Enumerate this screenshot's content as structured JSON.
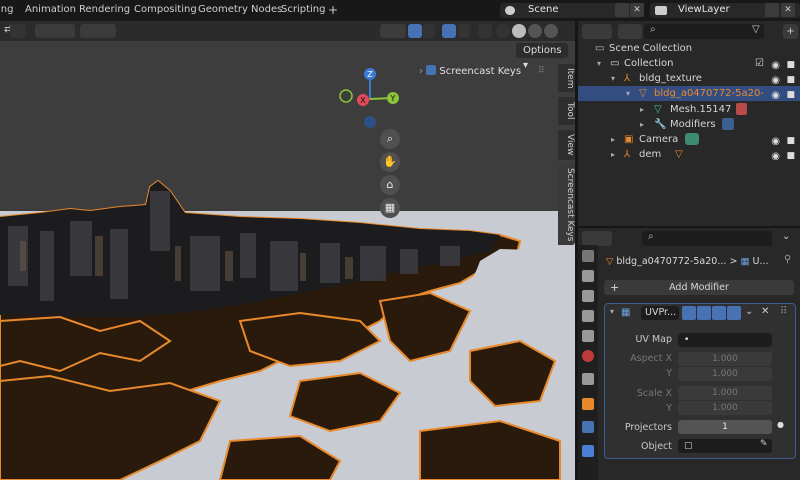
{
  "topbar": {
    "tabs": [
      "ing",
      "Animation",
      "Rendering",
      "Compositing",
      "Geometry Nodes",
      "Scripting"
    ],
    "add_tab": "+",
    "scene": "Scene",
    "view_layer": "ViewLayer"
  },
  "viewport": {
    "options": "Options",
    "screencast_label": "Screencast Keys",
    "side_tabs": [
      "Item",
      "Tool",
      "View",
      "Screencast Keys"
    ],
    "gizmo_axes": [
      "X",
      "Y",
      "Z"
    ]
  },
  "outliner": {
    "search_placeholder": "",
    "items": [
      {
        "label": "Scene Collection"
      },
      {
        "label": "Collection"
      },
      {
        "label": "bldg_texture"
      },
      {
        "label": "bldg_a0470772-5a20-"
      },
      {
        "label": "Mesh.15147"
      },
      {
        "label": "Modifiers"
      },
      {
        "label": "Camera"
      },
      {
        "label": "dem"
      }
    ]
  },
  "properties": {
    "breadcrumb_object": "bldg_a0470772-5a20...",
    "breadcrumb_sep": ">",
    "breadcrumb_mod": "U...",
    "add_modifier": "Add Modifier",
    "modifier_name": "UVPr...",
    "uv_map_label": "UV Map",
    "uv_map_value": "•",
    "aspect_x_label": "Aspect X",
    "aspect_x": "1.000",
    "aspect_y_label": "Y",
    "aspect_y": "1.000",
    "scale_x_label": "Scale X",
    "scale_x": "1.000",
    "scale_y_label": "Y",
    "scale_y": "1.000",
    "projectors_label": "Projectors",
    "projectors": "1",
    "object_label": "Object"
  },
  "colors": {
    "selection": "#334d80",
    "accent": "#4772b3",
    "outline_orange": "#e8892c",
    "ground": "#2a1a0c",
    "water": "#c9ccd2"
  }
}
